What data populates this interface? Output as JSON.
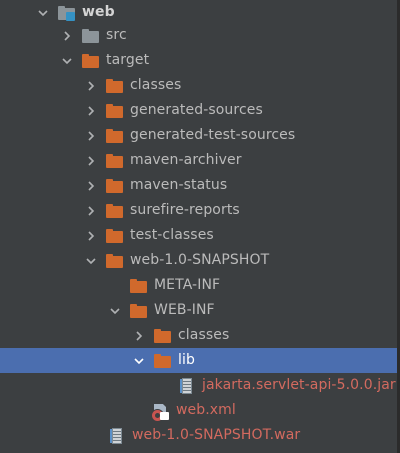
{
  "colors": {
    "background": "#3c3f41",
    "selection": "#4b6eaf",
    "folder_orange": "#d0692c",
    "folder_gray": "#8c9499",
    "module_blue": "#3592c4",
    "text": "#bbbbbb",
    "text_red": "#d36a5f"
  },
  "tree": {
    "rows": [
      {
        "label": "web",
        "icon": "module-folder-icon",
        "arrow": "chevron-down-icon"
      },
      {
        "label": "src",
        "icon": "folder-icon",
        "arrow": "chevron-right-icon"
      },
      {
        "label": "target",
        "icon": "folder-icon",
        "arrow": "chevron-down-icon"
      },
      {
        "label": "classes",
        "icon": "folder-icon",
        "arrow": "chevron-right-icon"
      },
      {
        "label": "generated-sources",
        "icon": "folder-icon",
        "arrow": "chevron-right-icon"
      },
      {
        "label": "generated-test-sources",
        "icon": "folder-icon",
        "arrow": "chevron-right-icon"
      },
      {
        "label": "maven-archiver",
        "icon": "folder-icon",
        "arrow": "chevron-right-icon"
      },
      {
        "label": "maven-status",
        "icon": "folder-icon",
        "arrow": "chevron-right-icon"
      },
      {
        "label": "surefire-reports",
        "icon": "folder-icon",
        "arrow": "chevron-right-icon"
      },
      {
        "label": "test-classes",
        "icon": "folder-icon",
        "arrow": "chevron-right-icon"
      },
      {
        "label": "web-1.0-SNAPSHOT",
        "icon": "folder-icon",
        "arrow": "chevron-down-icon"
      },
      {
        "label": "META-INF",
        "icon": "folder-icon",
        "arrow": "none"
      },
      {
        "label": "WEB-INF",
        "icon": "folder-icon",
        "arrow": "chevron-down-icon"
      },
      {
        "label": "classes",
        "icon": "folder-icon",
        "arrow": "chevron-right-icon"
      },
      {
        "label": "lib",
        "icon": "folder-icon",
        "arrow": "chevron-down-icon",
        "selected": true
      },
      {
        "label": "jakarta.servlet-api-5.0.0.jar",
        "icon": "jar-icon",
        "arrow": "none"
      },
      {
        "label": "web.xml",
        "icon": "xml-config-icon",
        "arrow": "none"
      },
      {
        "label": "web-1.0-SNAPSHOT.war",
        "icon": "jar-icon",
        "arrow": "none"
      }
    ]
  }
}
